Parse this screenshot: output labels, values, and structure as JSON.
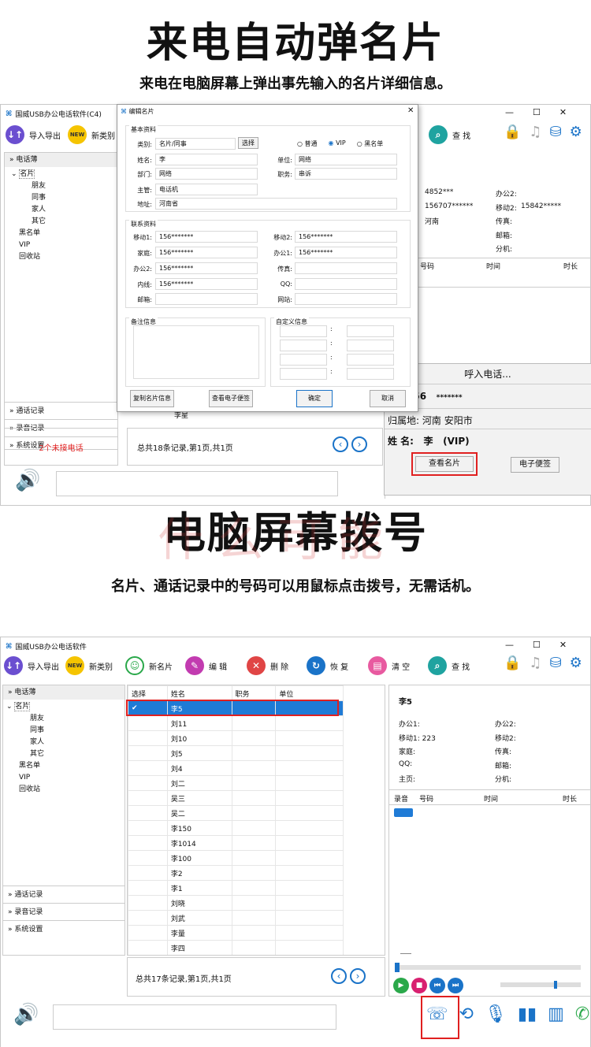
{
  "top": {
    "title": "来电自动弹名片",
    "subtitle": "来电在电脑屏幕上弹出事先输入的名片详细信息。"
  },
  "bottom": {
    "title": "电脑屏幕拨号",
    "subtitle": "名片、通话记录中的号码可以用鼠标点击拨号，无需话机。",
    "watermark": "什么可能"
  },
  "colors": {
    "accent": "#1a73c8",
    "highlight": "#e02020",
    "selected": "#1f7bd6"
  },
  "app1": {
    "window_title": "国威USB办公电话软件(C4)",
    "toolbar": {
      "import_export": "导入导出",
      "new_category": "新类别",
      "search": "查 找"
    },
    "tree": {
      "phonebook": "电话薄",
      "cards": "名片",
      "friends": "朋友",
      "colleagues": "同事",
      "family": "家人",
      "other": "其它",
      "blacklist": "黑名单",
      "vip": "VIP",
      "recycle": "回收站"
    },
    "sections": [
      "通话记录",
      "录音记录",
      "系统设置"
    ],
    "missed": "2个未接电话",
    "record_summary": "总共18条记录,第1页,共1页",
    "row_partial": "李星",
    "detail": {
      "office1_val": "4852***",
      "office2": "办公2:",
      "mobile1_val": "156707******",
      "mobile2": "移动2:",
      "mobile2_val": "15842*****",
      "home_val": "河南",
      "fax": "传真:",
      "email": "邮箱:",
      "ext": "分机:",
      "col_number": "号码",
      "col_time": "时间",
      "col_dur": "时长"
    },
    "popup": {
      "incoming": "呼入电话...",
      "number": "156",
      "number_mask": "*******",
      "origin_label": "归属地:",
      "origin_val": "河南 安阳市",
      "name_label": "姓 名:",
      "name_val": "李",
      "vip": "(VIP)",
      "view_card": "查看名片",
      "e_note": "电子便签"
    }
  },
  "dialog": {
    "title": "编辑名片",
    "basic": "基本资料",
    "category_label": "类别:",
    "category_val": "名片/同事",
    "select_btn": "选择",
    "radios": [
      "普通",
      "VIP",
      "黑名单"
    ],
    "name_label": "姓名:",
    "name_val": "李",
    "unit_label": "单位:",
    "unit_val": "网络",
    "dept_label": "部门:",
    "dept_val": "网络",
    "title_label": "职务:",
    "title_val": "串诉",
    "boss_label": "主管:",
    "boss_val": "电话机",
    "addr_label": "地址:",
    "addr_val": "河南省",
    "contact": "联系资料",
    "mobile1_label": "移动1:",
    "mobile1_val": "156*******",
    "mobile2_label": "移动2:",
    "mobile2_val": "156*******",
    "home_label": "家庭:",
    "home_val": "156*******",
    "office1_label": "办公1:",
    "office1_val": "156*******",
    "office2_label": "办公2:",
    "office2_val": "156*******",
    "fax_label": "传真:",
    "ext_label": "内线:",
    "ext_val": "156*******",
    "qq_label": "QQ:",
    "email_label": "邮箱:",
    "web_label": "网站:",
    "notes": "备注信息",
    "custom": "自定义信息",
    "copy_btn": "复制名片信息",
    "enote_btn": "查看电子便签",
    "ok_btn": "确定",
    "cancel_btn": "取消",
    "close": "✕"
  },
  "app2": {
    "window_title": "国威USB办公电话软件",
    "toolbar": {
      "import_export": "导入导出",
      "new_category": "新类别",
      "new_card": "新名片",
      "edit": "编 辑",
      "delete": "删 除",
      "restore": "恢 复",
      "clear": "清 空",
      "search": "查 找"
    },
    "tree": {
      "phonebook": "电话薄",
      "cards": "名片",
      "friends": "朋友",
      "colleagues": "同事",
      "family": "家人",
      "other": "其它",
      "blacklist": "黑名单",
      "vip": "VIP",
      "recycle": "回收站"
    },
    "sections": [
      "通话记录",
      "录音记录",
      "系统设置"
    ],
    "columns": [
      "选择",
      "姓名",
      "职务",
      "单位"
    ],
    "rows": [
      "李5",
      "刘11",
      "刘10",
      "刘5",
      "刘4",
      "刘二",
      "吴三",
      "吴二",
      "李150",
      "李1014",
      "李100",
      "李2",
      "李1",
      "刘晓",
      "刘武",
      "李量",
      "李四"
    ],
    "record_summary": "总共17条记录,第1页,共1页",
    "detail": {
      "name": "李5",
      "office1": "办公1:",
      "office2": "办公2:",
      "mobile1": "移动1: 223",
      "mobile2": "移动2:",
      "home": "家庭:",
      "fax": "传真:",
      "qq": "QQ:",
      "email": "邮箱:",
      "homepage": "主页:",
      "ext": "分机:",
      "col_rec": "录音",
      "col_number": "号码",
      "col_time": "时间",
      "col_dur": "时长"
    }
  }
}
